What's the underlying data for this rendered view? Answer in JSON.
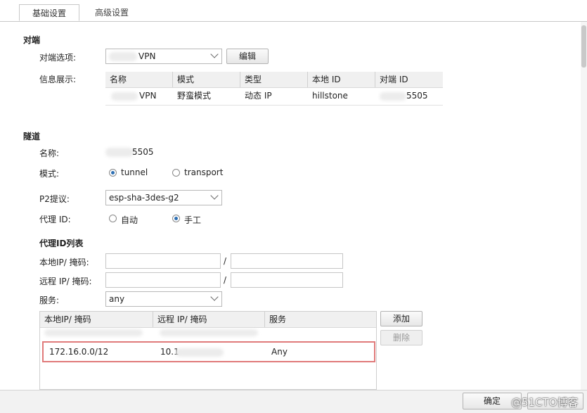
{
  "tabs": [
    {
      "label": "基础设置"
    },
    {
      "label": "高级设置"
    }
  ],
  "peer": {
    "section_title": "对端",
    "option_label": "对端选项:",
    "option_value": "VPN",
    "edit_label": "编辑",
    "info_label": "信息展示:",
    "table": {
      "headers": [
        "名称",
        "模式",
        "类型",
        "本地 ID",
        "对端 ID"
      ],
      "row": [
        "VPN",
        "野蛮模式",
        "动态 IP",
        "hillstone",
        "5505"
      ]
    }
  },
  "tunnel": {
    "section_title": "隧道",
    "name_label": "名称:",
    "name_value": "5505",
    "mode_label": "模式:",
    "mode_options": [
      "tunnel",
      "transport"
    ],
    "mode_selected": "tunnel",
    "p2_label": "P2提议:",
    "p2_value": "esp-sha-3des-g2",
    "proxy_id_label": "代理 ID:",
    "proxy_options": [
      "自动",
      "手工"
    ],
    "proxy_selected": "手工",
    "proxy_list_title": "代理ID列表",
    "local_label": "本地IP/ 掩码:",
    "remote_label": "远程 IP/ 掩码:",
    "slash": "/",
    "service_label": "服务:",
    "service_value": "any",
    "add_label": "添加",
    "delete_label": "删除",
    "list": {
      "headers": [
        "本地IP/ 掩码",
        "远程 IP/ 掩码",
        "服务"
      ],
      "rows": [
        [
          "172.16.0.0/12",
          "10.1",
          "Any"
        ]
      ]
    }
  },
  "footer": {
    "ok_label": "确定",
    "watermark": "@51CTO博客"
  }
}
